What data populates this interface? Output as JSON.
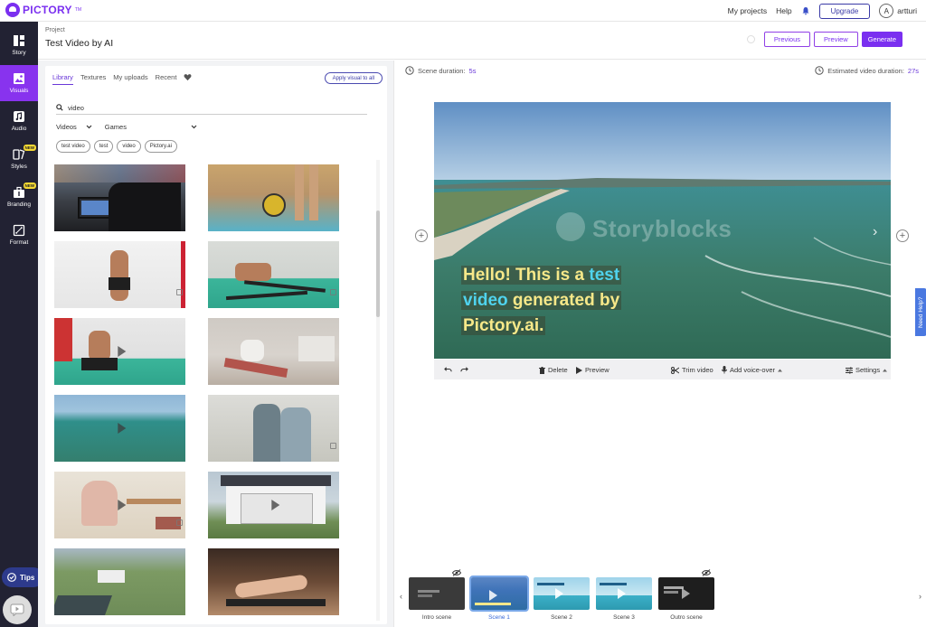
{
  "app": {
    "brand": "PICTORY",
    "brand_tm": "TM",
    "nav": {
      "my_projects": "My projects",
      "help": "Help",
      "upgrade": "Upgrade",
      "avatar_initial": "A",
      "username": "artturi"
    }
  },
  "sidebar": {
    "items": [
      {
        "label": "Story",
        "icon": "story-icon",
        "badge": ""
      },
      {
        "label": "Visuals",
        "icon": "visuals-icon",
        "badge": ""
      },
      {
        "label": "Audio",
        "icon": "audio-icon",
        "badge": ""
      },
      {
        "label": "Styles",
        "icon": "styles-icon",
        "badge": "NEW"
      },
      {
        "label": "Branding",
        "icon": "branding-icon",
        "badge": "NEW"
      },
      {
        "label": "Format",
        "icon": "format-icon",
        "badge": ""
      }
    ],
    "active": "Visuals",
    "tips_label": "Tips",
    "tips_count": "2"
  },
  "project": {
    "label": "Project",
    "title": "Test Video by AI",
    "actions": {
      "previous": "Previous",
      "preview": "Preview",
      "generate": "Generate"
    }
  },
  "visuals_panel": {
    "tabs": [
      "Library",
      "Textures",
      "My uploads",
      "Recent"
    ],
    "active_tab": "Library",
    "apply_all": "Apply visual to all",
    "search_value": "video",
    "filters": {
      "type": "Videos",
      "category": "Games"
    },
    "chips": [
      "test video",
      "test",
      "video",
      "Pictory.ai"
    ]
  },
  "scene": {
    "duration_label": "Scene duration:",
    "duration_value": "5s",
    "est_label": "Estimated video duration:",
    "est_value": "27s",
    "caption": {
      "line1_a": "Hello! This is a ",
      "line1_b": "test",
      "line2_a": "video",
      "line2_b": " generated by",
      "line3": "Pictory.ai."
    },
    "watermark": "Storyblocks",
    "toolbar": {
      "delete": "Delete",
      "preview": "Preview",
      "trim": "Trim video",
      "voice": "Add voice-over",
      "settings": "Settings"
    },
    "need_help": "Need Help?"
  },
  "timeline": {
    "scenes": [
      {
        "label": "Intro scene",
        "hidden": true
      },
      {
        "label": "Scene 1",
        "hidden": false,
        "active": true
      },
      {
        "label": "Scene 2",
        "hidden": false
      },
      {
        "label": "Scene 3",
        "hidden": false
      },
      {
        "label": "Outro scene",
        "hidden": true
      }
    ]
  },
  "colors": {
    "accent": "#7a2ff0",
    "sidebar": "#222233",
    "caption_yellow": "#f7e889",
    "caption_blue": "#4fd3ee"
  }
}
